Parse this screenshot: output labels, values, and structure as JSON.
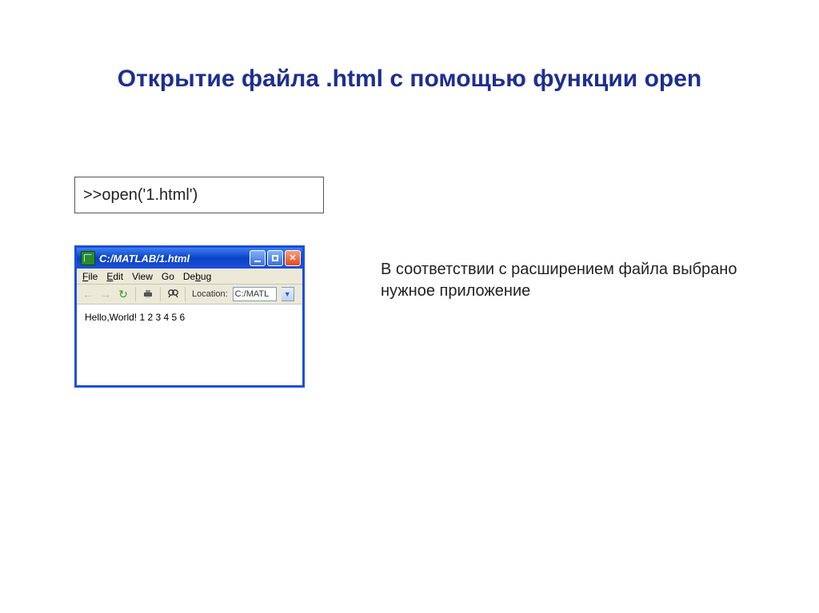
{
  "title": "Открытие файла .html с помощью функции open",
  "code": ">>open('1.html')",
  "caption": "В соответствии с расширением файла выбрано нужное приложение",
  "window": {
    "title": "C:/MATLAB/1.html",
    "menu": {
      "file": "File",
      "edit": "Edit",
      "view": "View",
      "go": "Go",
      "debug": "Debug"
    },
    "toolbar": {
      "location_label": "Location:",
      "location_value": "C:/MATL"
    },
    "content": "Hello,World! 1 2 3 4 5 6"
  }
}
